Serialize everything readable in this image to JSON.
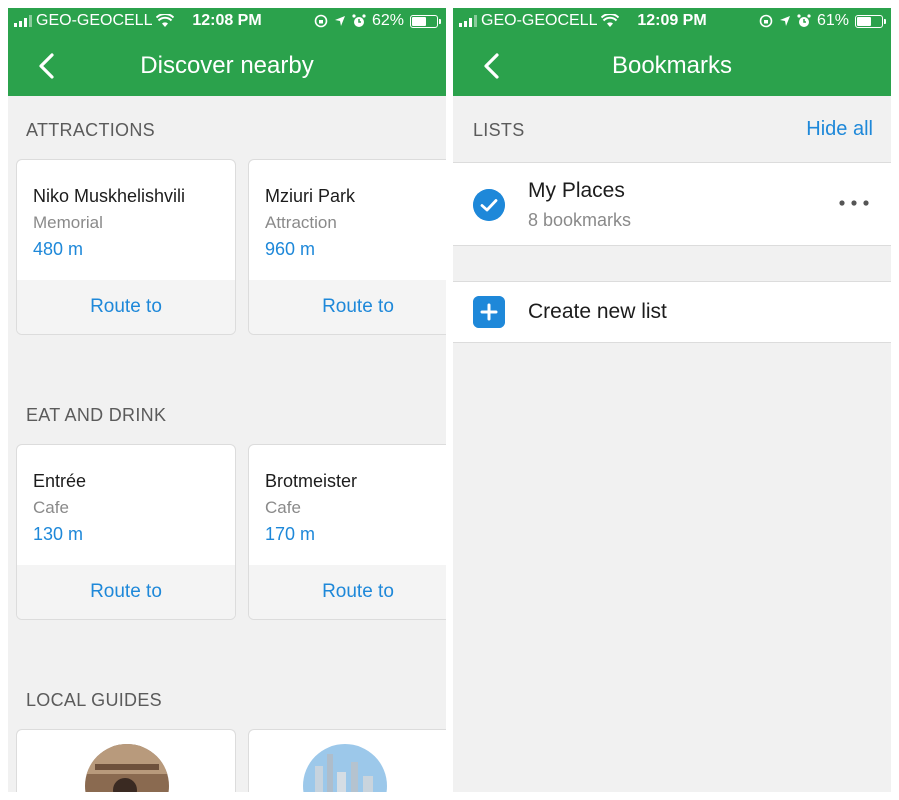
{
  "left": {
    "status": {
      "carrier": "GEO-GEOCELL",
      "time": "12:08 PM",
      "battery": "62%",
      "battery_level": 0.62
    },
    "title": "Discover nearby",
    "sections": {
      "attractions": {
        "title": "ATTRACTIONS",
        "cards": [
          {
            "name": "Niko Muskhelishvili",
            "type": "Memorial",
            "distance": "480 m",
            "action": "Route to"
          },
          {
            "name": "Mziuri Park",
            "type": "Attraction",
            "distance": "960 m",
            "action": "Route to"
          }
        ]
      },
      "eat": {
        "title": "EAT AND DRINK",
        "cards": [
          {
            "name": "Entrée",
            "type": "Cafe",
            "distance": "130 m",
            "action": "Route to"
          },
          {
            "name": "Brotmeister",
            "type": "Cafe",
            "distance": "170 m",
            "action": "Route to"
          }
        ]
      },
      "guides": {
        "title": "LOCAL GUIDES"
      }
    }
  },
  "right": {
    "status": {
      "carrier": "GEO-GEOCELL",
      "time": "12:09 PM",
      "battery": "61%",
      "battery_level": 0.61
    },
    "title": "Bookmarks",
    "lists_label": "LISTS",
    "hide_all": "Hide all",
    "list": {
      "name": "My Places",
      "count": "8 bookmarks"
    },
    "create_label": "Create new list"
  },
  "colors": {
    "accent_green": "#2ba24c",
    "link_blue": "#1e88d9"
  },
  "icons": [
    "signal-icon",
    "wifi-icon",
    "screen-lock-icon",
    "location-arrow-icon",
    "alarm-icon",
    "battery-icon",
    "back-chevron-icon",
    "check-circle-icon",
    "more-dots-icon",
    "plus-icon"
  ]
}
